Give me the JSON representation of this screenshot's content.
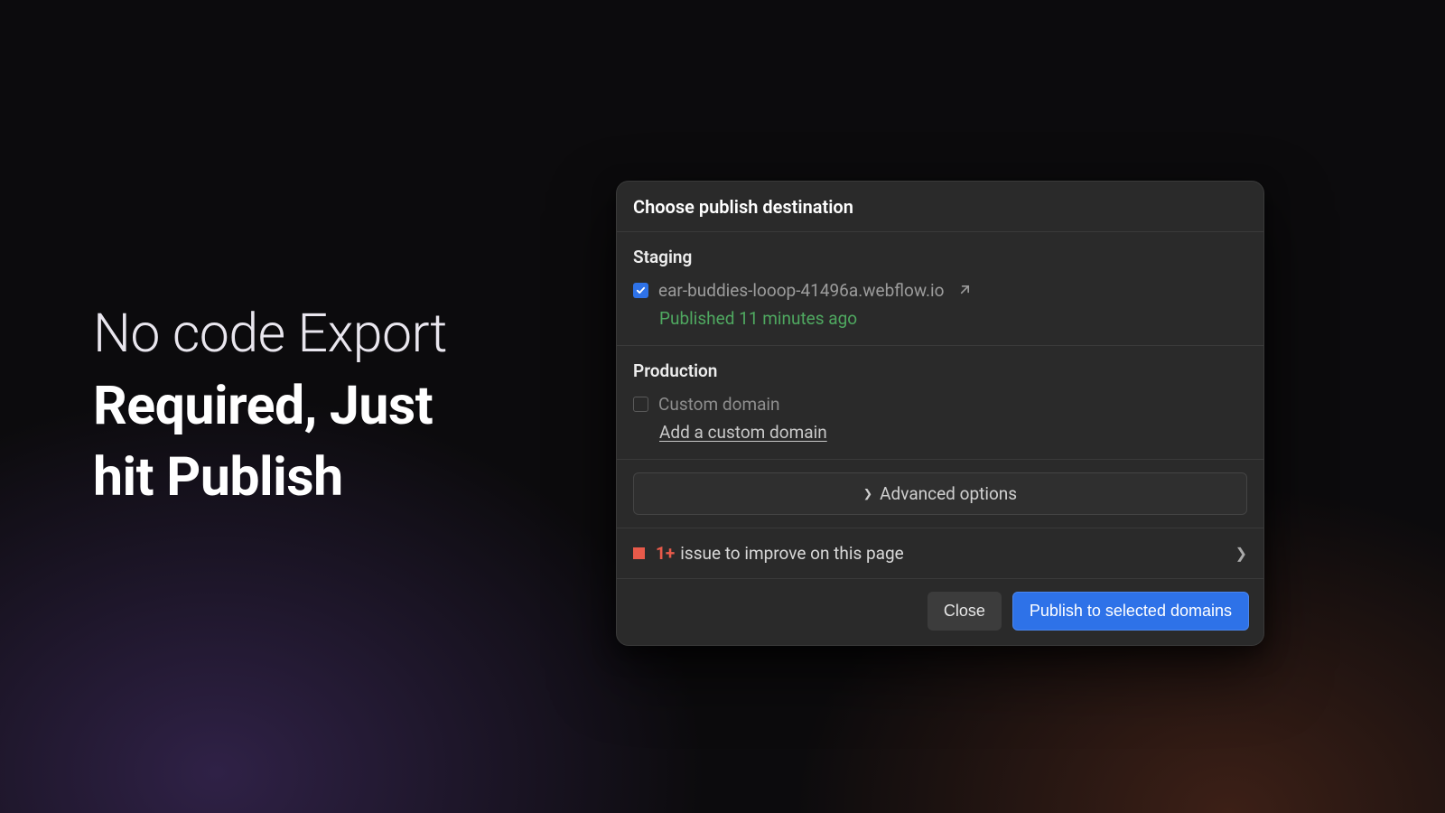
{
  "headline": {
    "line1": "No code Export",
    "line2": "Required, Just",
    "line3": "hit Publish"
  },
  "panel": {
    "title": "Choose publish destination",
    "staging": {
      "heading": "Staging",
      "domain": "ear-buddies-looop-41496a.webflow.io",
      "checked": true,
      "status": "Published 11 minutes ago"
    },
    "production": {
      "heading": "Production",
      "label": "Custom domain",
      "checked": false,
      "add_link": "Add a custom domain"
    },
    "advanced_label": "Advanced options",
    "issues": {
      "count": "1+",
      "text": "issue to improve on this page"
    },
    "footer": {
      "close": "Close",
      "publish": "Publish to selected domains"
    }
  }
}
